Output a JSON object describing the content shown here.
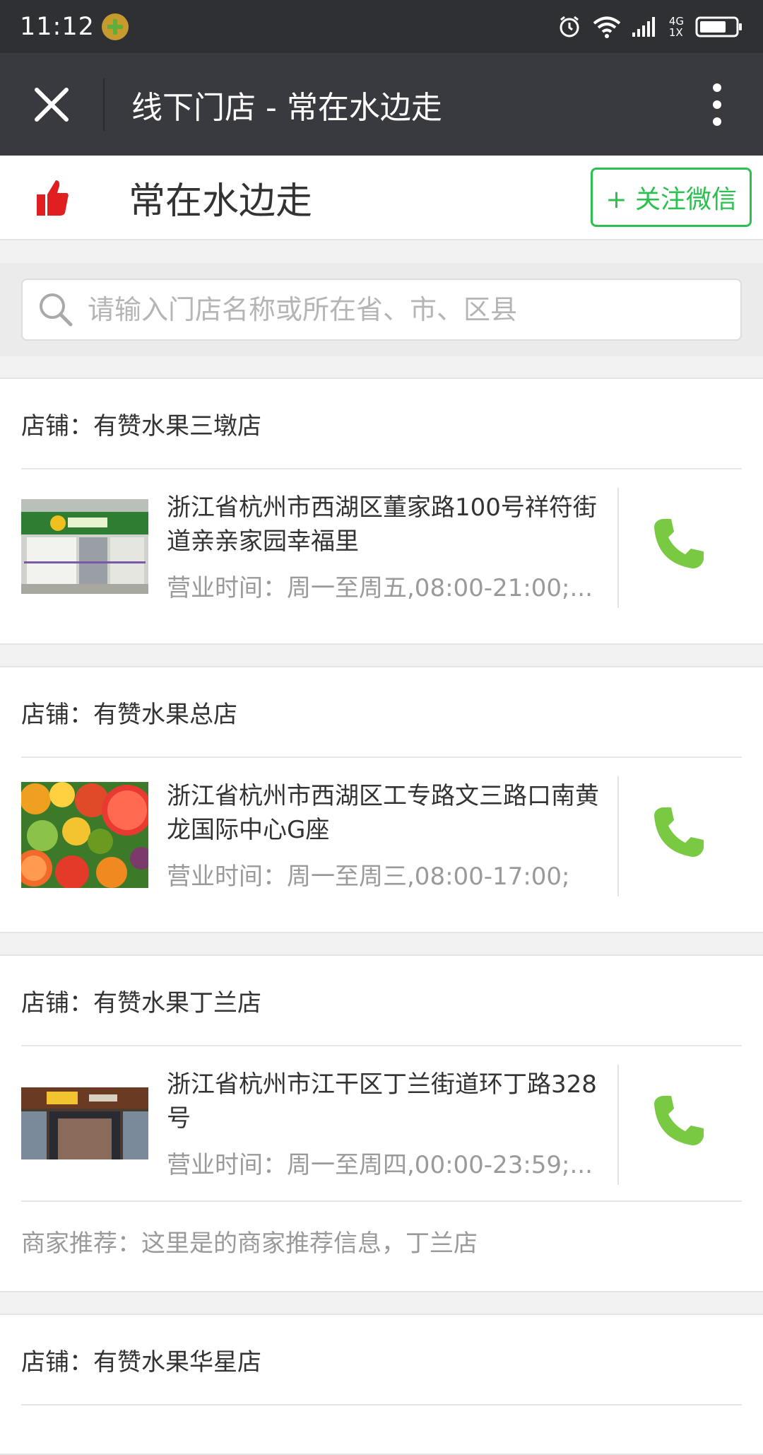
{
  "status_bar": {
    "time": "11:12",
    "network_top": "4G",
    "network_bottom": "1X"
  },
  "nav": {
    "title": "线下门店 - 常在水边走"
  },
  "header": {
    "brand_name": "常在水边走",
    "follow_label": "+ 关注微信"
  },
  "search": {
    "placeholder": "请输入门店名称或所在省、市、区县"
  },
  "stores": [
    {
      "title": "店铺：有赞水果三墩店",
      "address": "浙江省杭州市西湖区董家路100号祥符街道亲亲家园幸福里",
      "hours": "营业时间：周一至周五,08:00-21:00;..."
    },
    {
      "title": "店铺：有赞水果总店",
      "address": "浙江省杭州市西湖区工专路文三路口南黄龙国际中心G座",
      "hours": "营业时间：周一至周三,08:00-17:00;"
    },
    {
      "title": "店铺：有赞水果丁兰店",
      "address": "浙江省杭州市江干区丁兰街道环丁路328号",
      "hours": "营业时间：周一至周四,00:00-23:59;...",
      "recommend": "商家推荐：这里是的商家推荐信息，丁兰店"
    },
    {
      "title": "店铺：有赞水果华星店"
    }
  ],
  "colors": {
    "accent_green": "#2bc04f",
    "phone_green": "#7ac943",
    "nav_bg": "#393a3f",
    "status_bg": "#2e3034"
  }
}
